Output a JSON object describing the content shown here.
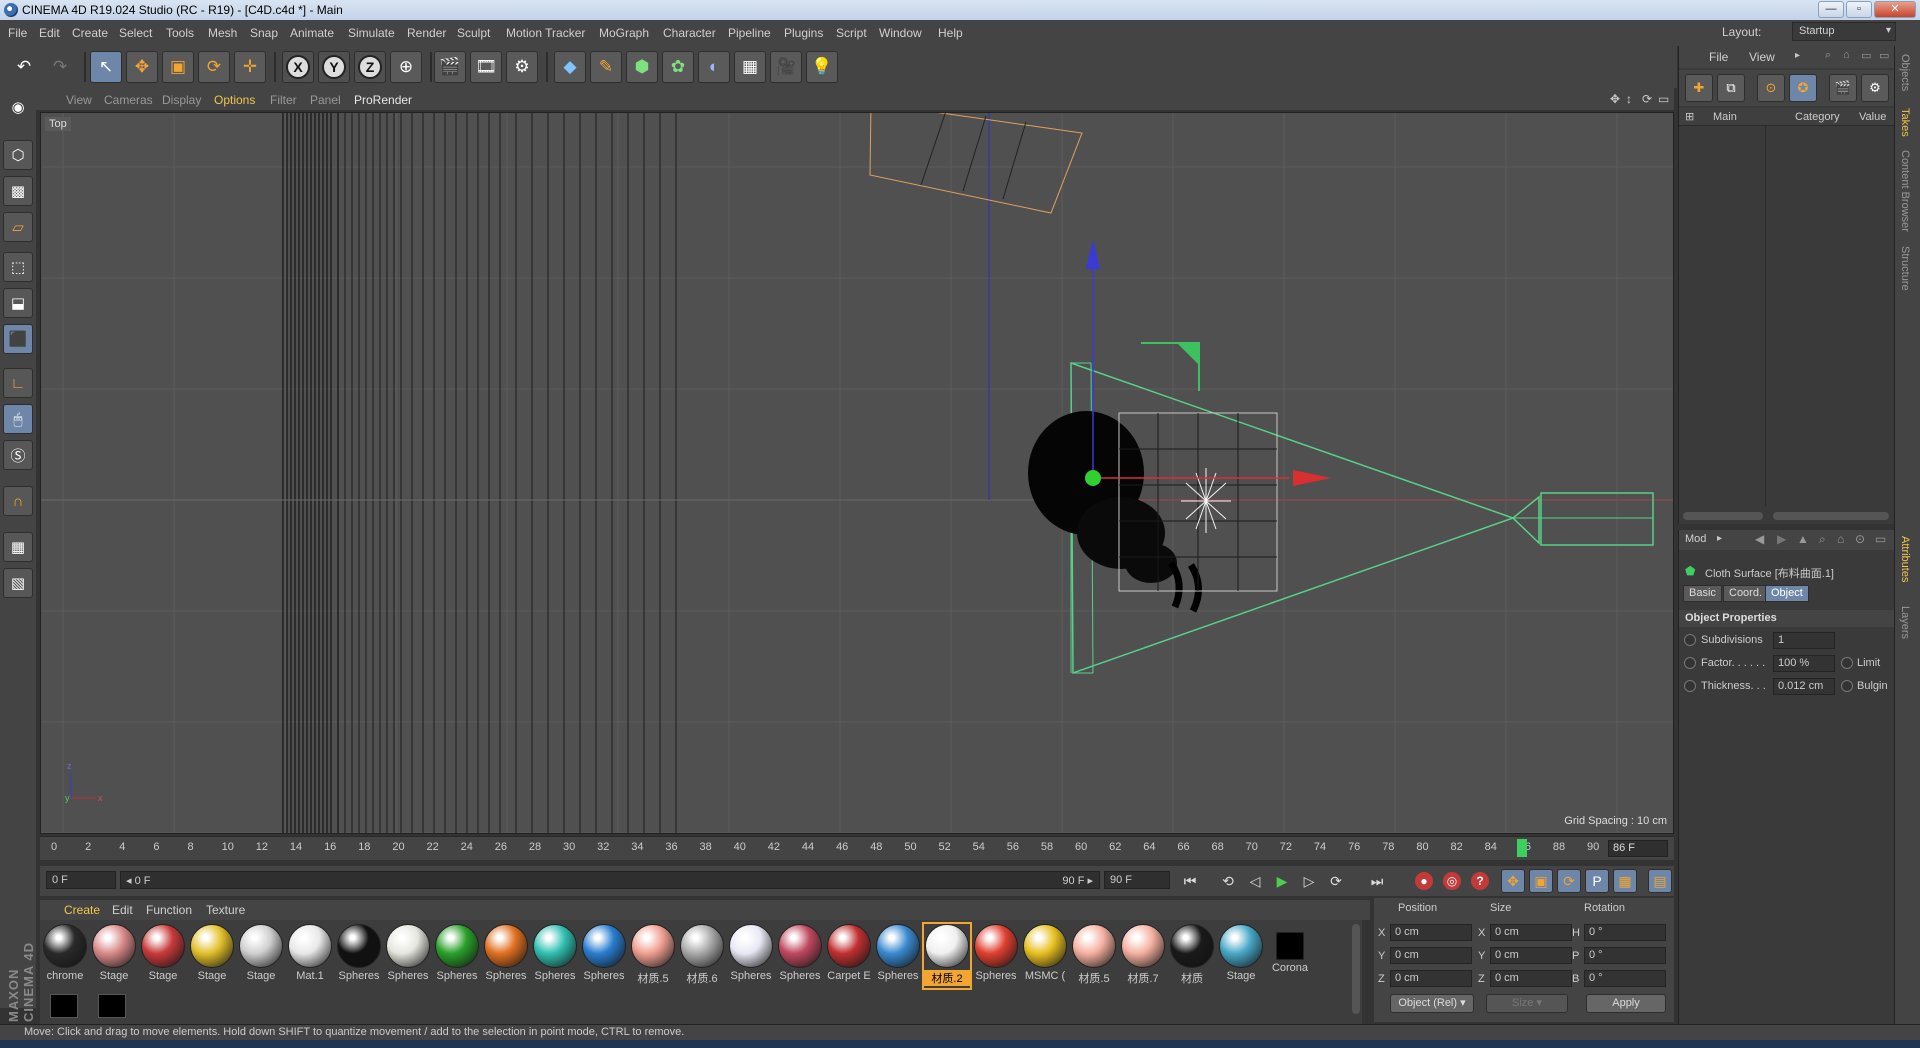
{
  "window": {
    "title": "CINEMA 4D R19.024 Studio (RC - R19) - [C4D.c4d *] - Main"
  },
  "menu": [
    "File",
    "Edit",
    "Create",
    "Select",
    "Tools",
    "Mesh",
    "Snap",
    "Animate",
    "Simulate",
    "Render",
    "Sculpt",
    "Motion Tracker",
    "MoGraph",
    "Character",
    "Pipeline",
    "Plugins",
    "Script",
    "Window",
    "Help"
  ],
  "layout": {
    "label": "Layout:",
    "value": "Startup"
  },
  "toolbar": {
    "axis_x": "X",
    "axis_y": "Y",
    "axis_z": "Z"
  },
  "viewport": {
    "menus": [
      "View",
      "Cameras",
      "Display",
      "Options",
      "Filter",
      "Panel",
      "ProRender"
    ],
    "highlight_menu": "Options",
    "camera": "Top",
    "grid_spacing": "Grid Spacing : 10 cm"
  },
  "timeline": {
    "ticks": [
      0,
      2,
      4,
      6,
      8,
      10,
      12,
      14,
      16,
      18,
      20,
      22,
      24,
      26,
      28,
      30,
      32,
      34,
      36,
      38,
      40,
      42,
      44,
      46,
      48,
      50,
      52,
      54,
      56,
      58,
      60,
      62,
      64,
      66,
      68,
      70,
      72,
      74,
      76,
      78,
      80,
      82,
      84,
      86,
      88,
      90
    ],
    "current_frame": "86 F",
    "playhead_frame": 86,
    "max_frame": 90
  },
  "playback": {
    "start": "0 F",
    "range_start": "◂ 0 F",
    "range_end": "90 F ▸",
    "end": "90 F"
  },
  "materials": {
    "menu": [
      "Create",
      "Edit",
      "Function",
      "Texture"
    ],
    "items": [
      {
        "name": "chrome",
        "color": "#2a2a2a"
      },
      {
        "name": "Stage",
        "color": "#d98a8a"
      },
      {
        "name": "Stage",
        "color": "#c83a3a"
      },
      {
        "name": "Stage",
        "color": "#e2c02a"
      },
      {
        "name": "Stage",
        "color": "#cfcfcf"
      },
      {
        "name": "Mat.1",
        "color": "#e8e8e8"
      },
      {
        "name": "Spheres",
        "color": "#111111"
      },
      {
        "name": "Spheres",
        "color": "#e6e6df"
      },
      {
        "name": "Spheres",
        "color": "#2aa02a"
      },
      {
        "name": "Spheres",
        "color": "#e07020"
      },
      {
        "name": "Spheres",
        "color": "#30c0b0"
      },
      {
        "name": "Spheres",
        "color": "#2a7ed0"
      },
      {
        "name": "材质.5",
        "color": "#f0a090"
      },
      {
        "name": "材质.6",
        "color": "#aaaaaa"
      },
      {
        "name": "Spheres",
        "color": "#e8e8f4"
      },
      {
        "name": "Spheres",
        "color": "#c04860"
      },
      {
        "name": "Carpet E",
        "color": "#c03030"
      },
      {
        "name": "Spheres",
        "color": "#3a8ad0"
      },
      {
        "name": "材质.2",
        "color": "#f0f0f0"
      },
      {
        "name": "Spheres",
        "color": "#e04030"
      },
      {
        "name": "MSMC (",
        "color": "#e8c020"
      },
      {
        "name": "材质.5",
        "color": "#f5b0a0"
      },
      {
        "name": "材质.7",
        "color": "#f5b0a0"
      },
      {
        "name": "材质",
        "color": "#1a1a1a"
      },
      {
        "name": "Stage",
        "color": "#48a8c8"
      },
      {
        "name": "Corona",
        "color": "#000000"
      }
    ],
    "row2": [
      "",
      ""
    ],
    "selected_index": 18
  },
  "coordinates": {
    "headers": [
      "Position",
      "Size",
      "Rotation"
    ],
    "rows": [
      {
        "axis": "X",
        "pos": "0 cm",
        "size_axis": "X",
        "size": "0 cm",
        "rot_axis": "H",
        "rot": "0 °"
      },
      {
        "axis": "Y",
        "pos": "0 cm",
        "size_axis": "Y",
        "size": "0 cm",
        "rot_axis": "P",
        "rot": "0 °"
      },
      {
        "axis": "Z",
        "pos": "0 cm",
        "size_axis": "Z",
        "size": "0 cm",
        "rot_axis": "B",
        "rot": "0 °"
      }
    ],
    "mode": "Object (Rel)",
    "size_mode": "Size",
    "apply": "Apply"
  },
  "object_manager": {
    "menu": [
      "File",
      "View"
    ],
    "columns": [
      "Main",
      "Category",
      "Value"
    ]
  },
  "attributes": {
    "mode": "Mod",
    "object_name": "Cloth Surface [布料曲面.1]",
    "tabs": [
      "Basic",
      "Coord.",
      "Object"
    ],
    "active_tab": "Object",
    "section": "Object Properties",
    "props": [
      {
        "label": "Subdivisions",
        "value": "1",
        "extra": ""
      },
      {
        "label": "Factor. . . . . .",
        "value": "100 %",
        "extra": "Limit"
      },
      {
        "label": "Thickness. . .",
        "value": "0.012 cm",
        "extra": "Bulgin"
      }
    ]
  },
  "side_tabs": [
    "Objects",
    "Takes",
    "Content Browser",
    "Structure",
    "Attributes",
    "Layers"
  ],
  "brand": "MAXON CINEMA 4D",
  "status": "Move: Click and drag to move elements. Hold down SHIFT to quantize movement / add to the selection in point mode, CTRL to remove."
}
